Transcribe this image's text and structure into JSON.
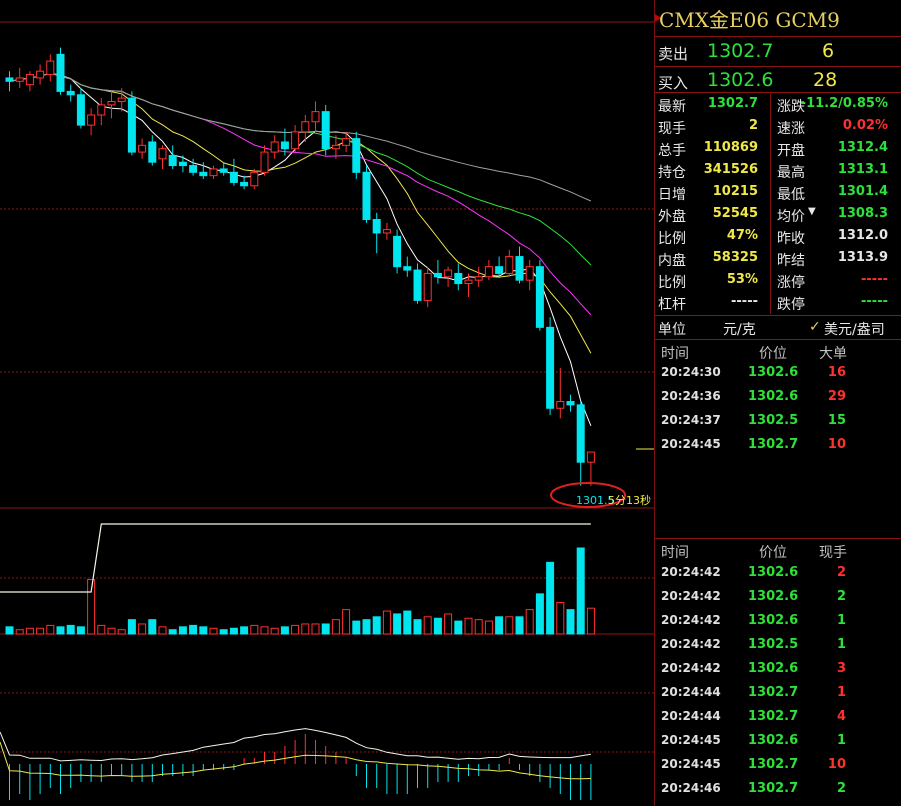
{
  "symbol": {
    "title": "CMX金E06  GCM9"
  },
  "colors": {
    "up": "#ff3030",
    "down": "#00e5ee",
    "ma5": "#ffffff",
    "ma10": "#f0e84a",
    "ma20": "#ff33ff",
    "ma30": "#2ee03a",
    "ma60": "#a0a0a0",
    "grid": "#8a1515"
  },
  "quote": {
    "sell_label": "卖出",
    "sell_price": "1302.7",
    "sell_qty": "6",
    "buy_label": "买入",
    "buy_price": "1302.6",
    "buy_qty": "28",
    "rows": [
      {
        "l1": "最新",
        "v1": "1302.7",
        "c1": "g",
        "l2": "涨跌",
        "v2": "-11.2/0.85%",
        "c2": "g"
      },
      {
        "l1": "现手",
        "v1": "2",
        "c1": "y",
        "l2": "速涨",
        "v2": "0.02%",
        "c2": "r"
      },
      {
        "l1": "总手",
        "v1": "110869",
        "c1": "y",
        "l2": "开盘",
        "v2": "1312.4",
        "c2": "g"
      },
      {
        "l1": "持仓",
        "v1": "341526",
        "c1": "y",
        "l2": "最高",
        "v2": "1313.1",
        "c2": "g"
      },
      {
        "l1": "日增",
        "v1": "10215",
        "c1": "y",
        "l2": "最低",
        "v2": "1301.4",
        "c2": "g"
      },
      {
        "l1": "外盘",
        "v1": "52545",
        "c1": "y",
        "l2": "均价",
        "v2": "1308.3",
        "c2": "g"
      },
      {
        "l1": "比例",
        "v1": "47%",
        "c1": "y",
        "l2": "昨收",
        "v2": "1312.0",
        "c2": "w"
      },
      {
        "l1": "内盘",
        "v1": "58325",
        "c1": "y",
        "l2": "昨结",
        "v2": "1313.9",
        "c2": "w"
      },
      {
        "l1": "比例",
        "v1": "53%",
        "c1": "y",
        "l2": "涨停",
        "v2": "-----",
        "c2": "r"
      },
      {
        "l1": "杠杆",
        "v1": "-----",
        "c1": "w",
        "l2": "跌停",
        "v2": "-----",
        "c2": "g"
      }
    ],
    "unit_label": "单位",
    "unit_value": "元/克",
    "unit_option": "美元/盎司"
  },
  "big_trades": {
    "headers": [
      "时间",
      "价位",
      "大单"
    ],
    "rows": [
      {
        "time": "20:24:30",
        "price": "1302.6",
        "qty": "16",
        "c": "r"
      },
      {
        "time": "20:24:36",
        "price": "1302.6",
        "qty": "29",
        "c": "r"
      },
      {
        "time": "20:24:37",
        "price": "1302.5",
        "qty": "15",
        "c": "g"
      },
      {
        "time": "20:24:45",
        "price": "1302.7",
        "qty": "10",
        "c": "r"
      }
    ]
  },
  "ticks": {
    "headers": [
      "时间",
      "价位",
      "现手"
    ],
    "rows": [
      {
        "time": "20:24:42",
        "price": "1302.6",
        "qty": "2",
        "c": "r"
      },
      {
        "time": "20:24:42",
        "price": "1302.6",
        "qty": "2",
        "c": "g"
      },
      {
        "time": "20:24:42",
        "price": "1302.6",
        "qty": "1",
        "c": "g"
      },
      {
        "time": "20:24:42",
        "price": "1302.5",
        "qty": "1",
        "c": "g"
      },
      {
        "time": "20:24:42",
        "price": "1302.6",
        "qty": "3",
        "c": "r"
      },
      {
        "time": "20:24:44",
        "price": "1302.7",
        "qty": "1",
        "c": "r"
      },
      {
        "time": "20:24:44",
        "price": "1302.7",
        "qty": "4",
        "c": "r"
      },
      {
        "time": "20:24:45",
        "price": "1302.6",
        "qty": "1",
        "c": "g"
      },
      {
        "time": "20:24:45",
        "price": "1302.7",
        "qty": "10",
        "c": "r"
      },
      {
        "time": "20:24:46",
        "price": "1302.7",
        "qty": "2",
        "c": "g"
      }
    ]
  },
  "chart_annotation": {
    "low_label": "1301.5",
    "countdown": "5分13秒"
  },
  "chart_data": {
    "type": "candlestick",
    "price_ylim": [
      1300.9,
      1315.2
    ],
    "candles": [
      {
        "o": 1313.6,
        "h": 1313.8,
        "l": 1313.2,
        "c": 1313.5
      },
      {
        "o": 1313.5,
        "h": 1313.9,
        "l": 1313.3,
        "c": 1313.6
      },
      {
        "o": 1313.4,
        "h": 1313.8,
        "l": 1313.2,
        "c": 1313.7
      },
      {
        "o": 1313.6,
        "h": 1314.0,
        "l": 1313.4,
        "c": 1313.8
      },
      {
        "o": 1313.7,
        "h": 1314.3,
        "l": 1313.5,
        "c": 1314.1
      },
      {
        "o": 1314.3,
        "h": 1314.5,
        "l": 1313.1,
        "c": 1313.2
      },
      {
        "o": 1313.2,
        "h": 1313.4,
        "l": 1312.9,
        "c": 1313.1
      },
      {
        "o": 1313.1,
        "h": 1313.3,
        "l": 1312.1,
        "c": 1312.2
      },
      {
        "o": 1312.2,
        "h": 1312.7,
        "l": 1311.9,
        "c": 1312.5
      },
      {
        "o": 1312.5,
        "h": 1313.0,
        "l": 1312.2,
        "c": 1312.8
      },
      {
        "o": 1312.8,
        "h": 1313.2,
        "l": 1312.4,
        "c": 1312.9
      },
      {
        "o": 1312.9,
        "h": 1313.3,
        "l": 1312.6,
        "c": 1313.0
      },
      {
        "o": 1313.0,
        "h": 1313.2,
        "l": 1311.3,
        "c": 1311.4
      },
      {
        "o": 1311.4,
        "h": 1311.8,
        "l": 1311.2,
        "c": 1311.6
      },
      {
        "o": 1311.7,
        "h": 1311.9,
        "l": 1311.0,
        "c": 1311.1
      },
      {
        "o": 1311.2,
        "h": 1311.6,
        "l": 1310.9,
        "c": 1311.5
      },
      {
        "o": 1311.3,
        "h": 1311.6,
        "l": 1310.9,
        "c": 1311.0
      },
      {
        "o": 1311.1,
        "h": 1311.3,
        "l": 1310.8,
        "c": 1311.0
      },
      {
        "o": 1311.0,
        "h": 1311.2,
        "l": 1310.7,
        "c": 1310.8
      },
      {
        "o": 1310.8,
        "h": 1311.1,
        "l": 1310.6,
        "c": 1310.7
      },
      {
        "o": 1310.7,
        "h": 1311.0,
        "l": 1310.6,
        "c": 1310.9
      },
      {
        "o": 1310.9,
        "h": 1311.1,
        "l": 1310.7,
        "c": 1310.8
      },
      {
        "o": 1310.8,
        "h": 1311.2,
        "l": 1310.4,
        "c": 1310.5
      },
      {
        "o": 1310.5,
        "h": 1310.7,
        "l": 1310.3,
        "c": 1310.4
      },
      {
        "o": 1310.4,
        "h": 1310.9,
        "l": 1310.3,
        "c": 1310.8
      },
      {
        "o": 1310.8,
        "h": 1311.6,
        "l": 1310.7,
        "c": 1311.4
      },
      {
        "o": 1311.4,
        "h": 1311.9,
        "l": 1311.2,
        "c": 1311.7
      },
      {
        "o": 1311.7,
        "h": 1312.1,
        "l": 1311.3,
        "c": 1311.5
      },
      {
        "o": 1311.5,
        "h": 1312.2,
        "l": 1311.4,
        "c": 1312.0
      },
      {
        "o": 1312.0,
        "h": 1312.5,
        "l": 1311.7,
        "c": 1312.3
      },
      {
        "o": 1312.3,
        "h": 1312.9,
        "l": 1312.0,
        "c": 1312.6
      },
      {
        "o": 1312.6,
        "h": 1312.8,
        "l": 1311.3,
        "c": 1311.5
      },
      {
        "o": 1311.5,
        "h": 1311.9,
        "l": 1311.2,
        "c": 1311.6
      },
      {
        "o": 1311.6,
        "h": 1312.0,
        "l": 1311.4,
        "c": 1311.8
      },
      {
        "o": 1311.8,
        "h": 1312.0,
        "l": 1310.6,
        "c": 1310.8
      },
      {
        "o": 1310.8,
        "h": 1311.0,
        "l": 1309.3,
        "c": 1309.4
      },
      {
        "o": 1309.4,
        "h": 1309.6,
        "l": 1308.4,
        "c": 1309.0
      },
      {
        "o": 1309.0,
        "h": 1309.3,
        "l": 1308.8,
        "c": 1309.1
      },
      {
        "o": 1308.9,
        "h": 1309.1,
        "l": 1307.8,
        "c": 1308.0
      },
      {
        "o": 1308.0,
        "h": 1308.3,
        "l": 1307.7,
        "c": 1307.9
      },
      {
        "o": 1307.9,
        "h": 1308.1,
        "l": 1306.9,
        "c": 1307.0
      },
      {
        "o": 1307.0,
        "h": 1308.0,
        "l": 1306.8,
        "c": 1307.8
      },
      {
        "o": 1307.8,
        "h": 1308.2,
        "l": 1307.5,
        "c": 1307.7
      },
      {
        "o": 1307.7,
        "h": 1308.0,
        "l": 1307.4,
        "c": 1307.9
      },
      {
        "o": 1307.8,
        "h": 1308.1,
        "l": 1307.3,
        "c": 1307.5
      },
      {
        "o": 1307.5,
        "h": 1307.8,
        "l": 1307.1,
        "c": 1307.6
      },
      {
        "o": 1307.6,
        "h": 1308.0,
        "l": 1307.4,
        "c": 1307.7
      },
      {
        "o": 1307.7,
        "h": 1308.2,
        "l": 1307.6,
        "c": 1308.0
      },
      {
        "o": 1308.0,
        "h": 1308.3,
        "l": 1307.7,
        "c": 1307.8
      },
      {
        "o": 1307.8,
        "h": 1308.5,
        "l": 1307.7,
        "c": 1308.3
      },
      {
        "o": 1308.3,
        "h": 1308.6,
        "l": 1307.5,
        "c": 1307.6
      },
      {
        "o": 1307.6,
        "h": 1308.2,
        "l": 1307.3,
        "c": 1308.0
      },
      {
        "o": 1308.0,
        "h": 1308.2,
        "l": 1306.1,
        "c": 1306.2
      },
      {
        "o": 1306.2,
        "h": 1306.5,
        "l": 1303.6,
        "c": 1303.8
      },
      {
        "o": 1303.8,
        "h": 1305.0,
        "l": 1303.5,
        "c": 1304.0
      },
      {
        "o": 1304.0,
        "h": 1304.2,
        "l": 1303.7,
        "c": 1303.9
      },
      {
        "o": 1303.9,
        "h": 1304.0,
        "l": 1301.5,
        "c": 1302.2
      },
      {
        "o": 1302.2,
        "h": 1302.5,
        "l": 1301.5,
        "c": 1302.5
      }
    ],
    "ma_periods": [
      "MA5",
      "MA10",
      "MA20",
      "MA30",
      "MA60"
    ],
    "volume": [
      5,
      3,
      4,
      4,
      6,
      5,
      6,
      5,
      38,
      6,
      4,
      3,
      10,
      7,
      10,
      5,
      3,
      5,
      6,
      5,
      4,
      3,
      4,
      5,
      6,
      5,
      4,
      5,
      6,
      7,
      7,
      7,
      10,
      17,
      9,
      10,
      12,
      16,
      14,
      16,
      10,
      12,
      11,
      14,
      9,
      11,
      10,
      9,
      12,
      12,
      12,
      17,
      28,
      50,
      22,
      17,
      60,
      18
    ],
    "open_interest": [
      1,
      1,
      1,
      1,
      1,
      1,
      1,
      1,
      1,
      9,
      9,
      9,
      9,
      9,
      9,
      9,
      9,
      9,
      9,
      9,
      9,
      9,
      9,
      9,
      9,
      9,
      9,
      9,
      9,
      9,
      9,
      9,
      9,
      9,
      9,
      9,
      9,
      9,
      9,
      9,
      9,
      9,
      9,
      9,
      9,
      9,
      9,
      9,
      9,
      9,
      9,
      9,
      9,
      9,
      9,
      9,
      9,
      9
    ],
    "macd_hist": [
      -6,
      -5,
      -6,
      -5,
      -4,
      -5,
      -4,
      -3,
      -3,
      -3,
      -2,
      -2,
      -3,
      -3,
      -3,
      -2,
      -2,
      -2,
      -2,
      -1,
      -1,
      -1,
      -1,
      1,
      1,
      2,
      2,
      3,
      4,
      5,
      4,
      3,
      2,
      1,
      -2,
      -4,
      -4,
      -5,
      -5,
      -5,
      -4,
      -4,
      -3,
      -3,
      -3,
      -2,
      -2,
      -1,
      -1,
      1,
      -1,
      -2,
      -3,
      -4,
      -5,
      -6,
      -6,
      -6
    ]
  }
}
